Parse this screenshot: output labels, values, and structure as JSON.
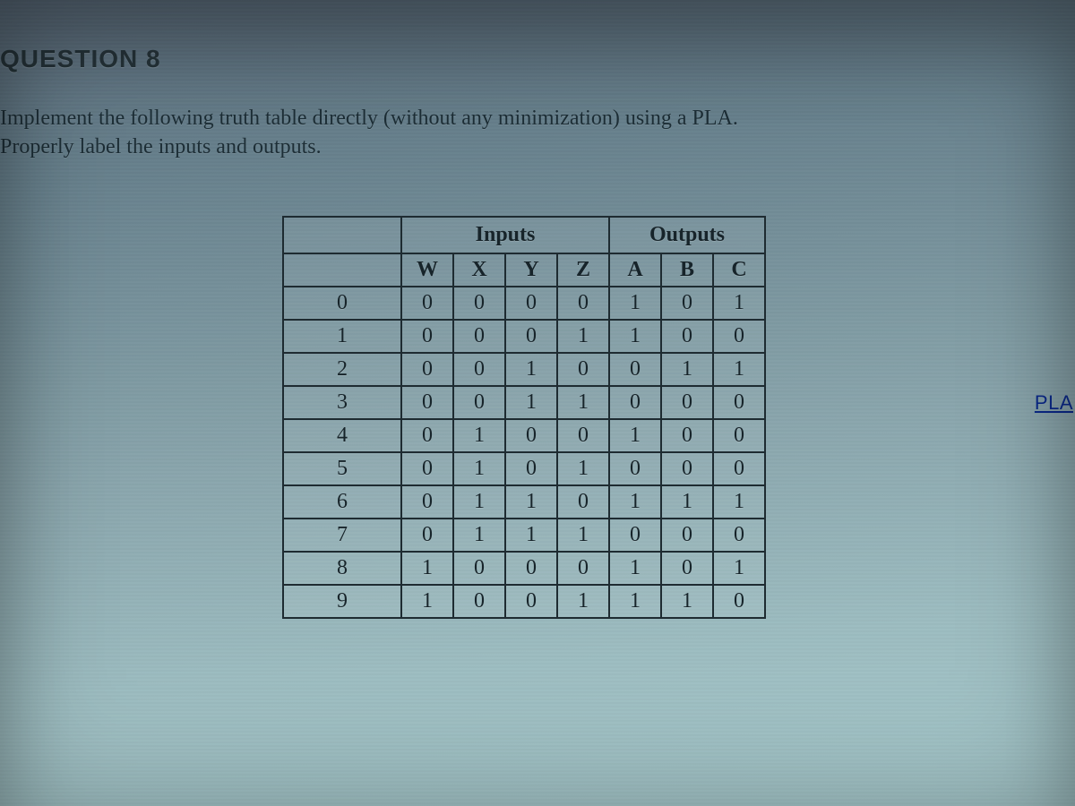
{
  "heading": "QUESTION 8",
  "prompt_html": "Implement the following truth table directly (without any minimization) using a PLA.<br>Properly label the inputs and outputs.",
  "side_label": "PLA",
  "table": {
    "group_headers": {
      "inputs": "Inputs",
      "outputs": "Outputs"
    },
    "columns": [
      "W",
      "X",
      "Y",
      "Z",
      "A",
      "B",
      "C"
    ],
    "rows": [
      {
        "idx": "0",
        "cells": [
          "0",
          "0",
          "0",
          "0",
          "1",
          "0",
          "1"
        ]
      },
      {
        "idx": "1",
        "cells": [
          "0",
          "0",
          "0",
          "1",
          "1",
          "0",
          "0"
        ]
      },
      {
        "idx": "2",
        "cells": [
          "0",
          "0",
          "1",
          "0",
          "0",
          "1",
          "1"
        ]
      },
      {
        "idx": "3",
        "cells": [
          "0",
          "0",
          "1",
          "1",
          "0",
          "0",
          "0"
        ]
      },
      {
        "idx": "4",
        "cells": [
          "0",
          "1",
          "0",
          "0",
          "1",
          "0",
          "0"
        ]
      },
      {
        "idx": "5",
        "cells": [
          "0",
          "1",
          "0",
          "1",
          "0",
          "0",
          "0"
        ]
      },
      {
        "idx": "6",
        "cells": [
          "0",
          "1",
          "1",
          "0",
          "1",
          "1",
          "1"
        ]
      },
      {
        "idx": "7",
        "cells": [
          "0",
          "1",
          "1",
          "1",
          "0",
          "0",
          "0"
        ]
      },
      {
        "idx": "8",
        "cells": [
          "1",
          "0",
          "0",
          "0",
          "1",
          "0",
          "1"
        ]
      },
      {
        "idx": "9",
        "cells": [
          "1",
          "0",
          "0",
          "1",
          "1",
          "1",
          "0"
        ]
      }
    ]
  },
  "chart_data": {
    "type": "table",
    "title": "Truth table for PLA implementation",
    "input_columns": [
      "W",
      "X",
      "Y",
      "Z"
    ],
    "output_columns": [
      "A",
      "B",
      "C"
    ],
    "rows": [
      {
        "index": 0,
        "W": 0,
        "X": 0,
        "Y": 0,
        "Z": 0,
        "A": 1,
        "B": 0,
        "C": 1
      },
      {
        "index": 1,
        "W": 0,
        "X": 0,
        "Y": 0,
        "Z": 1,
        "A": 1,
        "B": 0,
        "C": 0
      },
      {
        "index": 2,
        "W": 0,
        "X": 0,
        "Y": 1,
        "Z": 0,
        "A": 0,
        "B": 1,
        "C": 1
      },
      {
        "index": 3,
        "W": 0,
        "X": 0,
        "Y": 1,
        "Z": 1,
        "A": 0,
        "B": 0,
        "C": 0
      },
      {
        "index": 4,
        "W": 0,
        "X": 1,
        "Y": 0,
        "Z": 0,
        "A": 1,
        "B": 0,
        "C": 0
      },
      {
        "index": 5,
        "W": 0,
        "X": 1,
        "Y": 0,
        "Z": 1,
        "A": 0,
        "B": 0,
        "C": 0
      },
      {
        "index": 6,
        "W": 0,
        "X": 1,
        "Y": 1,
        "Z": 0,
        "A": 1,
        "B": 1,
        "C": 1
      },
      {
        "index": 7,
        "W": 0,
        "X": 1,
        "Y": 1,
        "Z": 1,
        "A": 0,
        "B": 0,
        "C": 0
      },
      {
        "index": 8,
        "W": 1,
        "X": 0,
        "Y": 0,
        "Z": 0,
        "A": 1,
        "B": 0,
        "C": 1
      },
      {
        "index": 9,
        "W": 1,
        "X": 0,
        "Y": 0,
        "Z": 1,
        "A": 1,
        "B": 1,
        "C": 0
      }
    ]
  }
}
